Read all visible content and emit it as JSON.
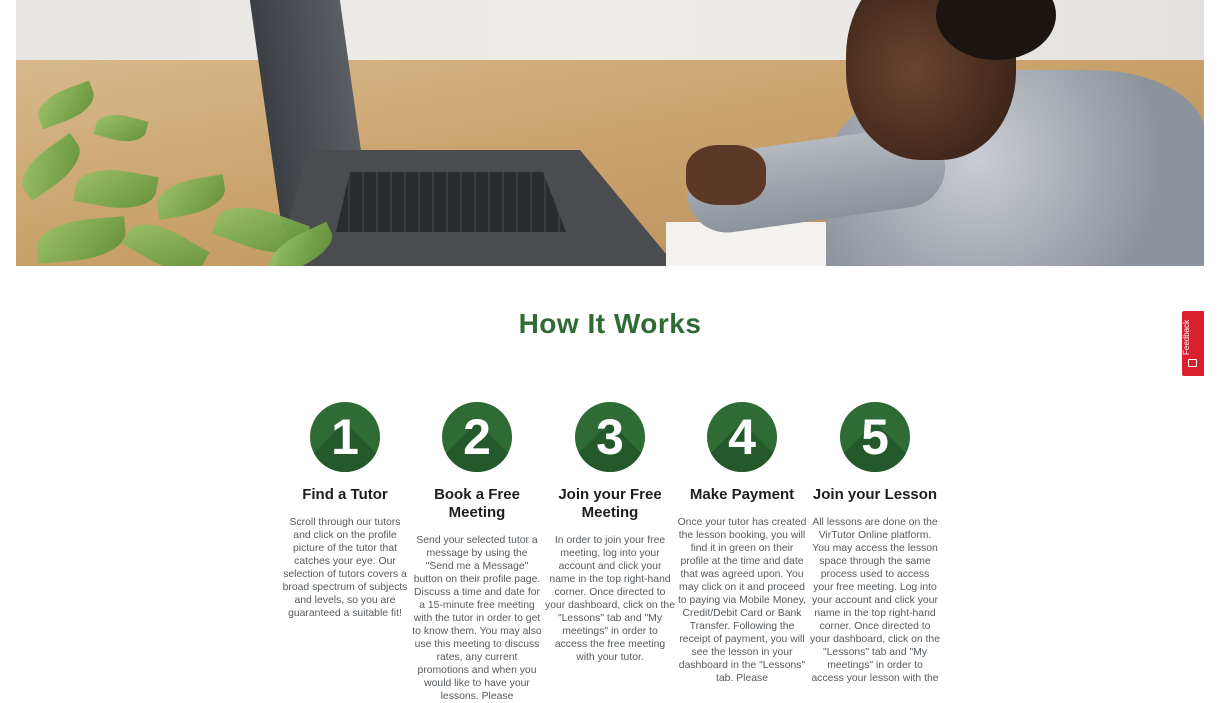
{
  "section": {
    "title": "How It Works"
  },
  "steps": [
    {
      "number": "1",
      "title": "Find a Tutor",
      "description": "Scroll through our tutors and click on the profile picture of the tutor that catches your eye. Our selection of tutors covers a broad spectrum of subjects and levels, so you are guaranteed a suitable fit!"
    },
    {
      "number": "2",
      "title": "Book a Free Meeting",
      "description": "Send your selected tutor a message by using the \"Send me a Message\" button on their profile page. Discuss a time and date for a 15-minute free meeting with the tutor in order to get to know them. You may also use this meeting to discuss rates, any current promotions and when you would like to have your lessons. Please"
    },
    {
      "number": "3",
      "title": "Join your Free Meeting",
      "description": "In order to join your free meeting, log into your account and click your name in the top right-hand corner. Once directed to your dashboard, click on the \"Lessons\" tab and \"My meetings\" in order to access the free meeting with your tutor."
    },
    {
      "number": "4",
      "title": "Make Payment",
      "description": "Once your tutor has created the lesson booking, you will find it in green on their profile at the time and date that was agreed upon. You may click on it and proceed to paying via Mobile Money, Credit/Debit Card or Bank Transfer. Following the receipt of payment, you will see the lesson in your dashboard in the \"Lessons\" tab. Please"
    },
    {
      "number": "5",
      "title": "Join your Lesson",
      "description": "All lessons are done on the VirTutor Online platform. You may access the lesson space through the same process used to access your free meeting. Log into your account and click your name in the top right-hand corner. Once directed to your dashboard, click on the \"Lessons\" tab and \"My meetings\" in order to access your lesson with the"
    }
  ],
  "feedback": {
    "label": "Feedback",
    "icon": "feedback-icon"
  },
  "colors": {
    "accent": "#2e6b35",
    "feedback": "#d8202f"
  }
}
